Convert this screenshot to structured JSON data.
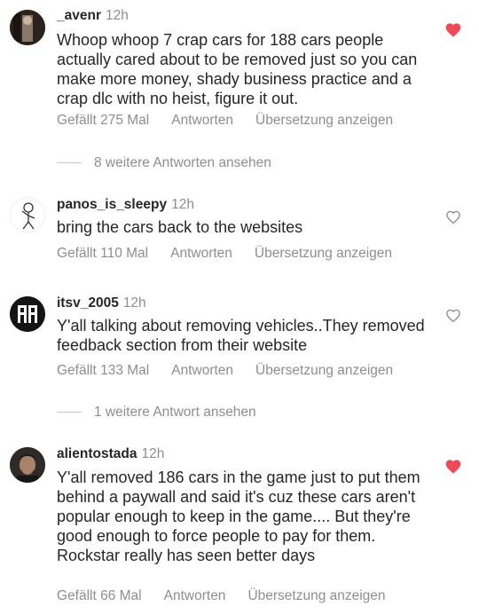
{
  "comments": [
    {
      "user": "_avenr",
      "time": "12h",
      "text": "Whoop whoop 7 crap cars for 188 cars people actually cared about to be removed just so you can make more money, shady business practice and a crap dlc with no heist, figure it out.",
      "likes": "Gefällt 275 Mal",
      "reply": "Antworten",
      "translate": "Übersetzung anzeigen",
      "liked": true
    },
    {
      "user": "panos_is_sleepy",
      "time": "12h",
      "text": "bring the cars back to the websites",
      "likes": "Gefällt 110 Mal",
      "reply": "Antworten",
      "translate": "Übersetzung anzeigen",
      "liked": false
    },
    {
      "user": "itsv_2005",
      "time": "12h",
      "text": "Y'all talking about removing vehicles..They removed feedback section from their website",
      "likes": "Gefällt 133 Mal",
      "reply": "Antworten",
      "translate": "Übersetzung anzeigen",
      "liked": false
    },
    {
      "user": "alientostada",
      "time": "12h",
      "text": "Y'all removed 186 cars in the game just to put them behind a paywall and said it's cuz these cars aren't popular enough to keep in the game.... But they're good enough to force people to pay for them. Rockstar really has seen better days",
      "likes": "Gefällt 66 Mal",
      "reply": "Antworten",
      "translate": "Übersetzung anzeigen",
      "liked": true
    }
  ],
  "view_replies": [
    "8 weitere Antworten ansehen",
    "1 weitere Antwort ansehen"
  ],
  "colors": {
    "text": "#262626",
    "secondary": "#8e8e8e",
    "heart_red": "#ed4956"
  }
}
